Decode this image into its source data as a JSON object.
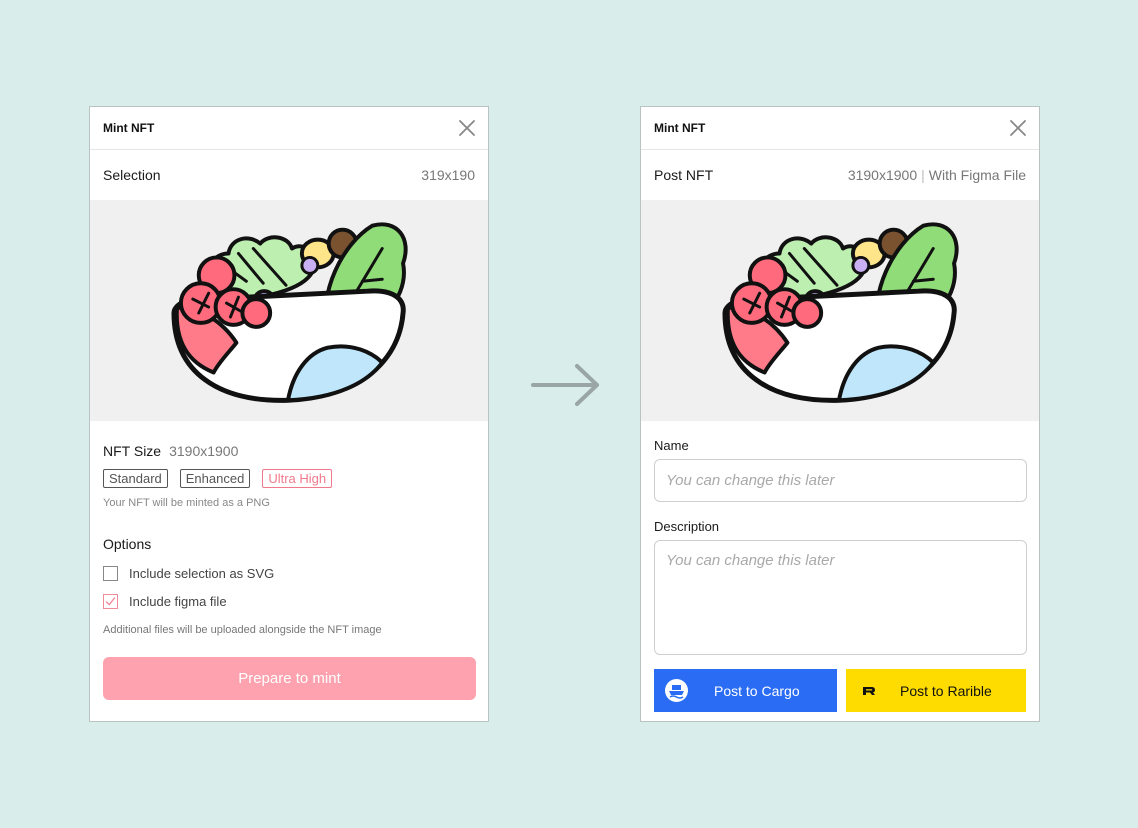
{
  "mint_panel": {
    "title": "Mint NFT",
    "selection_label": "Selection",
    "selection_size": "319x190",
    "nft_size_label": "NFT Size",
    "nft_size_value": "3190x1900",
    "size_options": [
      {
        "label": "Standard",
        "active": false
      },
      {
        "label": "Enhanced",
        "active": false
      },
      {
        "label": "Ultra High",
        "active": true
      }
    ],
    "format_hint": "Your NFT will be minted as a PNG",
    "options_title": "Options",
    "options": [
      {
        "label": "Include selection as SVG",
        "checked": false
      },
      {
        "label": "Include figma file",
        "checked": true
      }
    ],
    "footnote": "Additional files will be uploaded alongside the NFT image",
    "primary_button": "Prepare to mint"
  },
  "post_panel": {
    "title": "Mint NFT",
    "section_label": "Post NFT",
    "size": "3190x1900",
    "separator": "|",
    "extra": "With Figma File",
    "name_label": "Name",
    "name_placeholder": "You can change this later",
    "description_label": "Description",
    "description_placeholder": "You can change this later",
    "post_cargo_label": "Post to Cargo",
    "post_rarible_label": "Post to Rarible"
  },
  "colors": {
    "background": "#d9edea",
    "accent_pink": "#f07a8c",
    "primary_button": "#fda2ae",
    "cargo_blue": "#2a6df4",
    "rarible_yellow": "#ffdc00"
  },
  "icons": {
    "close": "close-icon",
    "arrow": "arrow-right-icon",
    "checkmark": "checkmark-icon",
    "cargo": "cargo-logo-icon",
    "rarible": "rarible-logo-icon"
  }
}
